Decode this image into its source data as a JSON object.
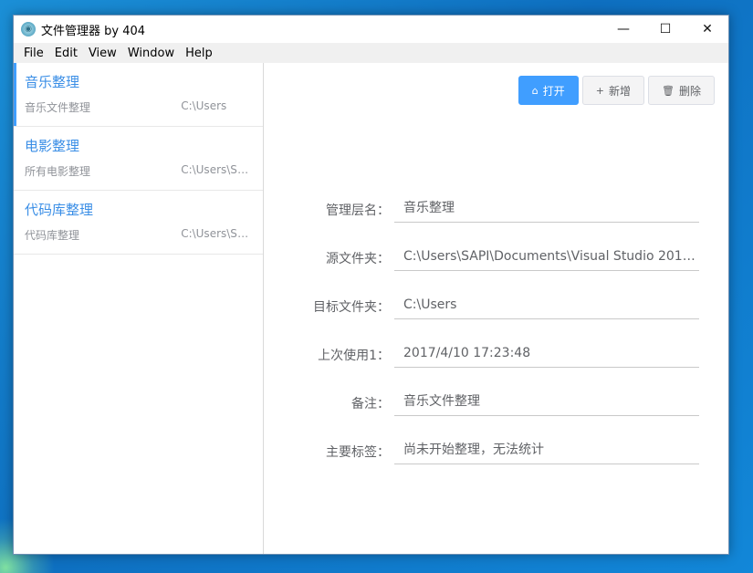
{
  "window": {
    "title": "文件管理器 by 404",
    "minimize": "—",
    "maximize": "☐",
    "close": "✕"
  },
  "menu": [
    "File",
    "Edit",
    "View",
    "Window",
    "Help"
  ],
  "sidebar": {
    "items": [
      {
        "title": "音乐整理",
        "desc": "音乐文件整理",
        "path": "C:\\Users",
        "active": true
      },
      {
        "title": "电影整理",
        "desc": "所有电影整理",
        "path": "C:\\Users\\SA...",
        "active": false
      },
      {
        "title": "代码库整理",
        "desc": "代码库整理",
        "path": "C:\\Users\\SA...",
        "active": false
      }
    ]
  },
  "toolbar": {
    "open": {
      "label": "打开",
      "icon": "home-icon",
      "glyph": "⌂"
    },
    "add": {
      "label": "新增",
      "icon": "plus-icon",
      "glyph": "+"
    },
    "delete": {
      "label": "删除",
      "icon": "trash-icon",
      "glyph": "🗑"
    }
  },
  "form": {
    "fields": [
      {
        "label": "管理层名：",
        "value": "音乐整理"
      },
      {
        "label": "源文件夹：",
        "value": "C:\\Users\\SAPI\\Documents\\Visual Studio 2010\\P..."
      },
      {
        "label": "目标文件夹：",
        "value": "C:\\Users"
      },
      {
        "label": "上次使用1：",
        "value": "2017/4/10 17:23:48"
      },
      {
        "label": "备注：",
        "value": "音乐文件整理"
      },
      {
        "label": "主要标签：",
        "value": "尚未开始整理，无法统计"
      }
    ]
  },
  "colors": {
    "accent": "#409eff",
    "title_blue": "#3a8ee6",
    "muted": "#909399"
  }
}
